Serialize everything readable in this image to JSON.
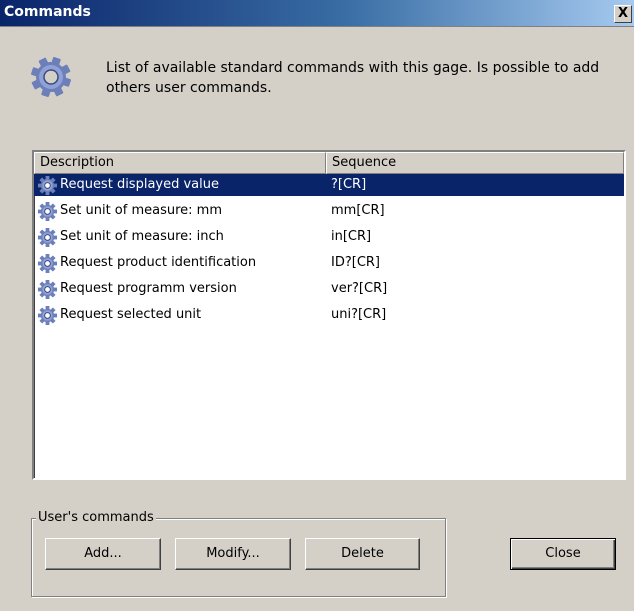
{
  "window": {
    "title": "Commands",
    "close_glyph": "X"
  },
  "header": {
    "icon": "gear-icon",
    "description": "List of available standard commands with this gage. Is possible to add others user commands."
  },
  "list": {
    "columns": [
      "Description",
      "Sequence"
    ],
    "rows": [
      {
        "description": "Request displayed value",
        "sequence": "?[CR]",
        "selected": true
      },
      {
        "description": "Set unit of measure: mm",
        "sequence": "mm[CR]",
        "selected": false
      },
      {
        "description": "Set unit of measure: inch",
        "sequence": "in[CR]",
        "selected": false
      },
      {
        "description": "Request product identification",
        "sequence": "ID?[CR]",
        "selected": false
      },
      {
        "description": "Request programm version",
        "sequence": "ver?[CR]",
        "selected": false
      },
      {
        "description": "Request selected unit",
        "sequence": "uni?[CR]",
        "selected": false
      }
    ],
    "selection_color": "#0a246a"
  },
  "user_commands": {
    "label": "User's commands",
    "add": "Add...",
    "modify": "Modify...",
    "delete": "Delete"
  },
  "close_button": "Close"
}
